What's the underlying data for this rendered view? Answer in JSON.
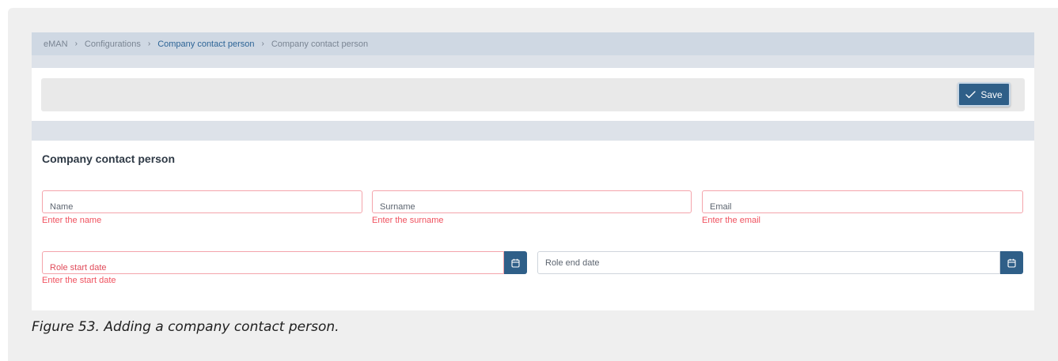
{
  "breadcrumb": {
    "items": [
      "eMAN",
      "Configurations",
      "Company contact person",
      "Company contact person"
    ],
    "separator": "›"
  },
  "toolbar": {
    "save_label": "Save",
    "save_icon": "check-icon"
  },
  "form": {
    "title": "Company contact person",
    "fields": {
      "name": {
        "label": "Name",
        "error": "Enter the name"
      },
      "surname": {
        "label": "Surname",
        "error": "Enter the surname"
      },
      "email": {
        "label": "Email",
        "error": "Enter the email"
      },
      "role_start": {
        "label": "Role start date",
        "error": "Enter the start date",
        "icon": "calendar-icon"
      },
      "role_end": {
        "label": "Role end date",
        "icon": "calendar-icon"
      }
    }
  },
  "caption": "Figure 53. Adding a company contact person.",
  "colors": {
    "primary": "#2f5f88",
    "error": "#f0525f",
    "error_border": "#f4a4ab",
    "breadcrumb_bg": "#cfd8e3",
    "link": "#2d6496"
  }
}
